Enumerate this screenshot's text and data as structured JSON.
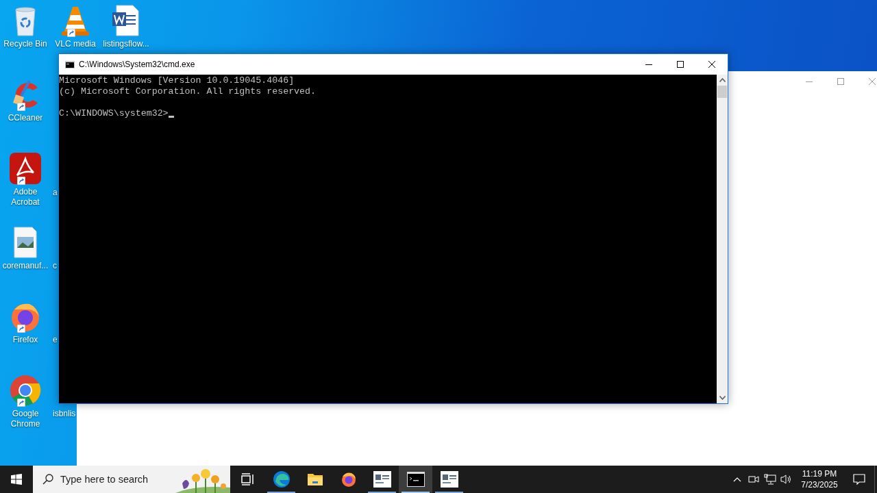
{
  "desktop": {
    "icons": [
      {
        "label": "Recycle Bin",
        "kind": "recycle-bin",
        "shortcut": false
      },
      {
        "label": "VLC media",
        "kind": "cone",
        "shortcut": true
      },
      {
        "label": "listingsflow...",
        "kind": "word-document",
        "shortcut": false
      },
      {
        "label": "CCleaner",
        "kind": "broom",
        "shortcut": true
      },
      {
        "label": "Adobe Acrobat",
        "kind": "acrobat",
        "shortcut": true
      },
      {
        "label": "coremanuf...",
        "kind": "image-file",
        "shortcut": false
      },
      {
        "label": "Firefox",
        "kind": "firefox",
        "shortcut": true
      },
      {
        "label": "Google Chrome",
        "kind": "chrome",
        "shortcut": true
      }
    ],
    "cut_labels": [
      "a",
      "c",
      "e",
      "isbnlis"
    ]
  },
  "console_window": {
    "title": "C:\\Windows\\System32\\cmd.exe",
    "lines": [
      "Microsoft Windows [Version 10.0.19045.4046]",
      "(c) Microsoft Corporation. All rights reserved."
    ],
    "prompt": "C:\\WINDOWS\\system32>"
  },
  "background_window": {
    "kind": "blank"
  },
  "taskbar": {
    "search": {
      "placeholder": "Type here to search"
    },
    "apps": [
      {
        "kind": "task-view",
        "running": false,
        "selected": false
      },
      {
        "kind": "edge",
        "running": true,
        "selected": false
      },
      {
        "kind": "folder",
        "running": false,
        "selected": false
      },
      {
        "kind": "firefox",
        "running": false,
        "selected": false
      },
      {
        "kind": "document",
        "running": true,
        "selected": false
      },
      {
        "kind": "terminal",
        "running": true,
        "selected": true
      },
      {
        "kind": "document",
        "running": true,
        "selected": false
      }
    ],
    "time": "11:19 PM",
    "date": "7/23/2025"
  }
}
